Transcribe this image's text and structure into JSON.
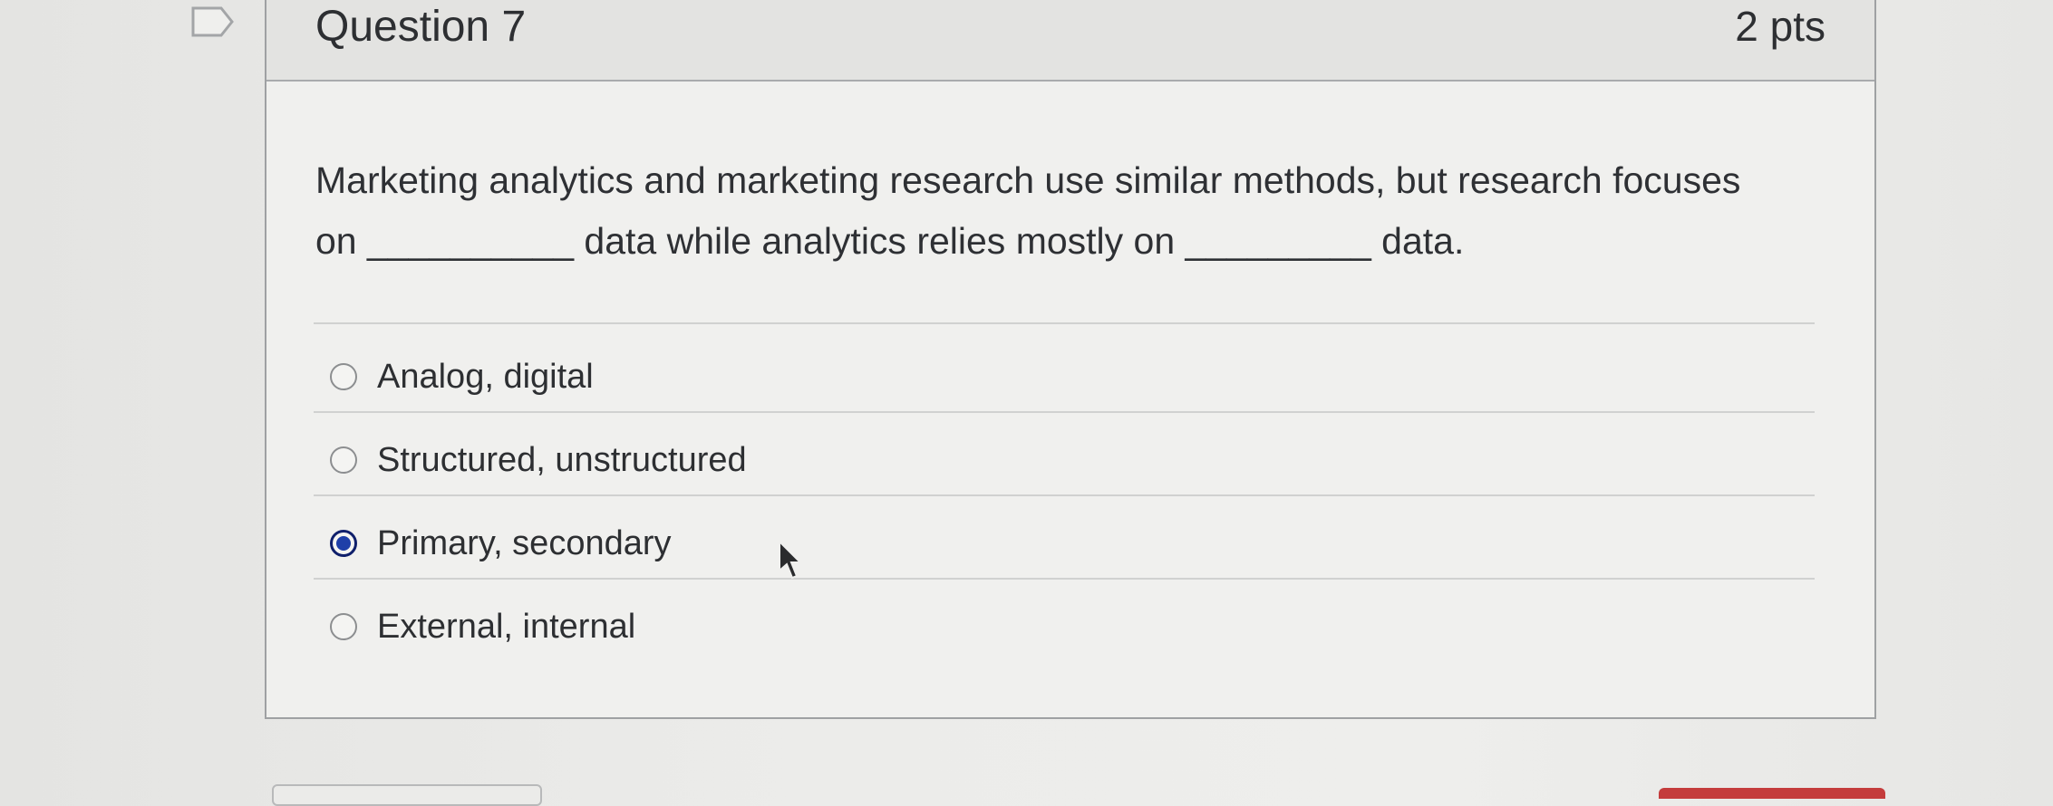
{
  "question": {
    "title": "Question 7",
    "points": "2 pts",
    "text_line1": "Marketing analytics and marketing research use similar methods, but research focuses",
    "text_line2": "on __________ data while analytics relies mostly on _________ data."
  },
  "answers": [
    {
      "label": "Analog, digital",
      "selected": false
    },
    {
      "label": "Structured, unstructured",
      "selected": false
    },
    {
      "label": "Primary, secondary",
      "selected": true
    },
    {
      "label": "External, internal",
      "selected": false
    }
  ],
  "colors": {
    "selected_radio": "#1e3fa8",
    "header_bg": "#e3e3e1",
    "card_border": "#9fa1a3"
  },
  "icons": {
    "flag": "question-flag-icon",
    "cursor": "mouse-pointer-icon"
  }
}
